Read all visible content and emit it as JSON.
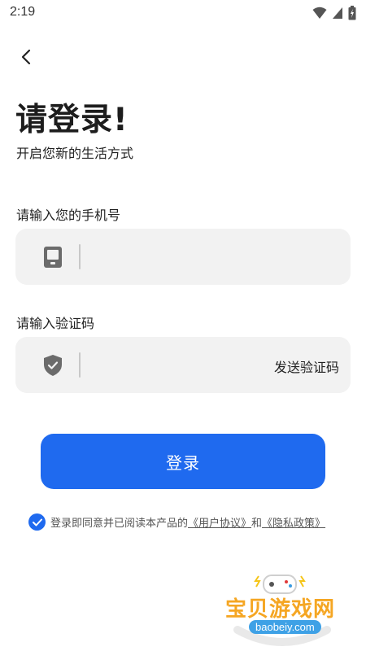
{
  "status_bar": {
    "time": "2:19"
  },
  "page": {
    "title": "请登录!",
    "subtitle": "开启您新的生活方式"
  },
  "phone_field": {
    "label": "请输入您的手机号",
    "value": "",
    "placeholder": ""
  },
  "code_field": {
    "label": "请输入验证码",
    "value": "",
    "placeholder": "",
    "send_code_label": "发送验证码"
  },
  "login_button": {
    "label": "登录"
  },
  "agreement": {
    "checked": true,
    "prefix": "登录即同意并已阅读本产品的",
    "user_agreement": "《用户协议》",
    "conjunction": "和",
    "privacy_policy": "《隐私政策》"
  },
  "watermark": {
    "title": "宝贝游戏网",
    "url": "baobeiy.com"
  },
  "colors": {
    "accent": "#1f6aef",
    "field_bg": "#f2f2f2",
    "icon_gray": "#6b6b6b"
  },
  "icons": {
    "back": "chevron-left-icon",
    "phone": "phone-icon",
    "shield": "shield-check-icon",
    "check": "check-icon",
    "wifi": "wifi-icon",
    "signal": "signal-icon",
    "battery": "battery-icon"
  }
}
